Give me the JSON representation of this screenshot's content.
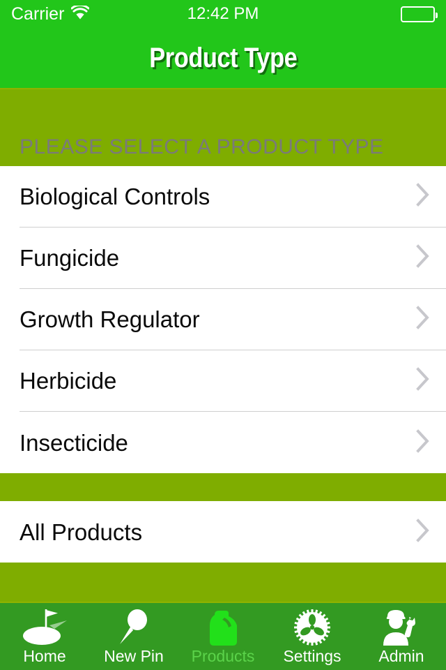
{
  "status_bar": {
    "carrier": "Carrier",
    "wifi_icon": "wifi-icon",
    "time": "12:42 PM",
    "battery_icon": "battery-icon"
  },
  "nav_bar": {
    "title": "Product Type"
  },
  "section": {
    "header": "PLEASE SELECT A PRODUCT TYPE"
  },
  "product_types": [
    {
      "label": "Biological Controls",
      "accessory": "chevron-right-icon"
    },
    {
      "label": "Fungicide",
      "accessory": "chevron-right-icon"
    },
    {
      "label": "Growth Regulator",
      "accessory": "chevron-right-icon"
    },
    {
      "label": "Herbicide",
      "accessory": "chevron-right-icon"
    },
    {
      "label": "Insecticide",
      "accessory": "chevron-right-icon"
    }
  ],
  "all_products": [
    {
      "label": "All Products",
      "accessory": "chevron-right-icon"
    }
  ],
  "tab_bar": {
    "items": [
      {
        "label": "Home",
        "icon": "golf-green-flag-icon",
        "active": false
      },
      {
        "label": "New Pin",
        "icon": "map-pin-icon",
        "active": false
      },
      {
        "label": "Products",
        "icon": "chemical-jug-icon",
        "active": true
      },
      {
        "label": "Settings",
        "icon": "gear-icon",
        "active": false
      },
      {
        "label": "Admin",
        "icon": "worker-wrench-icon",
        "active": false
      }
    ]
  },
  "colors": {
    "nav_green": "#22c61a",
    "olive_green": "#7fad00",
    "tabbar_green": "#339a22",
    "active_tab_green": "#5bd34a",
    "cell_white": "#ffffff",
    "cell_text": "#0a0a0a",
    "section_header_text": "#7a7a7a",
    "chevron_gray": "#c7c7cc"
  }
}
